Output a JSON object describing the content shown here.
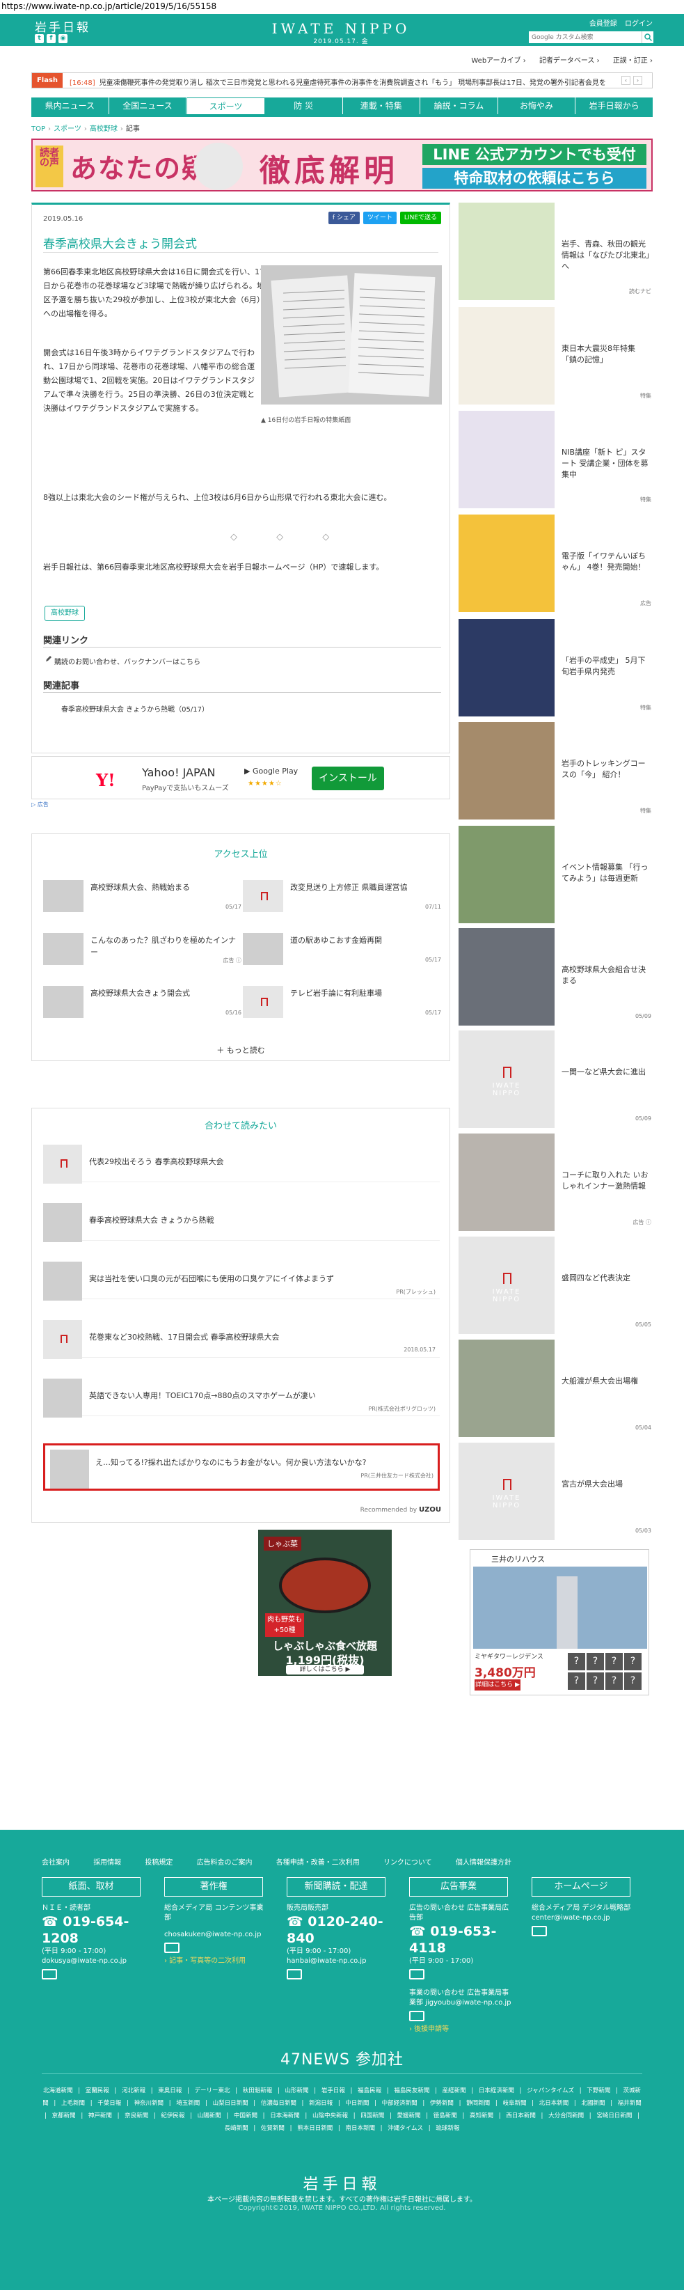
{
  "url": "https://www.iwate-np.co.jp/article/2019/5/16/55158",
  "header": {
    "logo": "岩手日報",
    "brand": "IWATE NIPPO",
    "date": "2019.05.17. 金",
    "links": [
      "会員登録",
      "ログイン"
    ],
    "search_placeholder": "Google カスタム検索",
    "social_icons": [
      "twitter-icon",
      "facebook-icon",
      "rss-icon"
    ]
  },
  "util_links": [
    "Webアーカイブ ›",
    "記者データベース ›",
    "正誤・訂正 ›"
  ],
  "flash": {
    "label": "Flash",
    "date": "[16:48]",
    "text": "児童凍傷鞭死事件の発覚取り消し 稲次で三日市発覚と思われる児童虐待死事件の消事件を消費院調査され「もう」 現場刑事部長は17日、発覚の署外引記者会見を行い",
    "prev": "‹",
    "next": "›"
  },
  "nav": {
    "items": [
      "県内ニュース",
      "全国ニュース",
      "スポーツ",
      "防 災",
      "連載・特集",
      "論説・コラム",
      "お悔やみ",
      "岩手日報から"
    ],
    "active_index": 2
  },
  "breadcrumb": [
    "TOP",
    "スポーツ",
    "高校野球",
    "記事"
  ],
  "banner": {
    "kuchi": "読者の声",
    "title": "あなたの疑問",
    "tettei": "徹底解明",
    "line1": "LINE 公式アカウントでも受付",
    "line2": "特命取材の依頼はこちら"
  },
  "article": {
    "date": "2019.05.16",
    "share": [
      "f シェア",
      "ツイート",
      "LINEで送る"
    ],
    "headline": "春季高校県大会きょう開会式",
    "p1": "第66回春季東北地区高校野球県大会は16日に開会式を行い、17日から花巻市の花巻球場など3球場で熱戦が繰り広げられる。地区予選を勝ち抜いた29校が参加し、上位3校が東北大会（6月）への出場権を得る。",
    "p2": "開会式は16日午後3時からイワテグランドスタジアムで行われ、17日から同球場、花巻市の花巻球場、八幡平市の総合運動公園球場で1、2回戦を実施。20日はイワテグランドスタジアムで準々決勝を行う。25日の準決勝、26日の3位決定戦と決勝はイワテグランドスタジアムで実施する。",
    "photo_caption": "16日付の岩手日報の特集紙面",
    "p3": "8強以上は東北大会のシード権が与えられ、上位3校は6月6日から山形県で行われる東北大会に進む。",
    "diamonds": "◇ ◇ ◇",
    "p4": "岩手日報社は、第66回春季東北地区高校野球県大会を岩手日報ホームページ（HP）で速報します。",
    "tag": "高校野球",
    "related_links_heading": "関連リンク",
    "related_link": "購読のお問い合わせ、バックナンバーはこちら",
    "related_articles_heading": "関連記事",
    "related_article": "春季高校野球県大会 きょうから熱戦（05/17）"
  },
  "ad_yahoo": {
    "logo": "Y!",
    "name": "Yahoo! JAPAN",
    "desc": "PayPayで支払いもスムーズ",
    "store": "Google Play",
    "stars": "★★★★☆",
    "install": "インストール",
    "ad_mark": "▷ 広告"
  },
  "access": {
    "title": "アクセス上位",
    "items": [
      {
        "text": "高校野球県大会、熱戦始まる",
        "date": "05/17",
        "thumb": "photo"
      },
      {
        "text": "改変見送り上方修正 県職員運営協",
        "date": "07/11",
        "thumb": "placeholder"
      },
      {
        "text": "こんなのあった？肌ざわりを極めたインナー",
        "date": "広告 ⓘ",
        "thumb": "photo"
      },
      {
        "text": "道の駅あゆこおす金婚再開",
        "date": "05/17",
        "thumb": "photo"
      },
      {
        "text": "高校野球県大会きょう開会式",
        "date": "05/16",
        "thumb": "photo"
      },
      {
        "text": "テレビ岩手論に有利駐車場",
        "date": "05/17",
        "thumb": "placeholder"
      }
    ],
    "more": "＋ もっと読む"
  },
  "recommend": {
    "title": "合わせて読みたい",
    "items": [
      {
        "text": "代表29校出そろう 春季高校野球県大会",
        "meta": "",
        "thumb": "placeholder"
      },
      {
        "text": "春季高校野球県大会 きょうから熱戦",
        "meta": "",
        "thumb": "photo"
      },
      {
        "text": "実は当社を使い口臭の元が石団喉にも使用の口臭ケアにイイ体よまうず",
        "meta": "PR(ブレッシュ)",
        "thumb": "photo"
      },
      {
        "text": "花巻東など30校熱戦、17日開会式 春季高校野球県大会",
        "meta": "2018.05.17",
        "thumb": "placeholder"
      },
      {
        "text": "英語できない人専用！TOEIC170点→880点のスマホゲームが凄い",
        "meta": "PR(株式会社ポリグロッツ)",
        "thumb": "photo"
      }
    ],
    "highlight": {
      "text": "え…知ってる!?採れ出たばかりなのにもうお金がない。何か良い方法ないかな?",
      "meta": "PR(三井住友カード株式会社)",
      "thumb": "photo"
    },
    "by_label": "Recommended by",
    "by_brand": "UZOU"
  },
  "ad_shabu": {
    "brand": "しゃぶ菜",
    "tag": "肉も野菜も +50種",
    "copy": "しゃぶしゃぶ食べ放題",
    "price": "1,199円(税抜)",
    "btn": "詳しくはこちら ▶"
  },
  "ad_tower": {
    "brand": "三井のリハウス",
    "name": "ミヤギタワーレジデンス",
    "price": "3,480万円",
    "btn": "詳細はこちら ▶",
    "marks": [
      "?",
      "?",
      "?",
      "?",
      "?",
      "?",
      "?",
      "?"
    ]
  },
  "sidebar": [
    {
      "text": "岩手、青森、秋田の観光情報は「なびたび北東北」へ",
      "meta": "読むナビ",
      "thumb": "photo"
    },
    {
      "text": "東日本大震災8年特集 「鎮の記憶」",
      "meta": "特集",
      "thumb": "photo"
    },
    {
      "text": "NIB講座「新ト ピ」スタート 受講企業・団体を募集中",
      "meta": "特集",
      "thumb": "photo"
    },
    {
      "text": "電子版「イワテんいぼちゃん」 4巻！発売開始！",
      "meta": "広告",
      "thumb": "photo"
    },
    {
      "text": "「岩手の平成史」 5月下旬岩手県内発売",
      "meta": "特集",
      "thumb": "photo"
    },
    {
      "text": "岩手のトレッキングコースの「今」 紹介！",
      "meta": "特集",
      "thumb": "photo"
    },
    {
      "text": "イベント情報募集 「行ってみよう」は毎週更新",
      "meta": "",
      "thumb": "photo"
    },
    {
      "text": "高校野球県大会組合せ決まる",
      "meta": "05/09",
      "thumb": "photo"
    },
    {
      "text": "一関一など県大会に進出",
      "meta": "05/09",
      "thumb": "placeholder"
    },
    {
      "text": "コーチに取り入れた いおしゃれインナー激熱情報",
      "meta": "広告 ⓘ",
      "thumb": "photo"
    },
    {
      "text": "盛岡四など代表決定",
      "meta": "05/05",
      "thumb": "placeholder"
    },
    {
      "text": "大船渡が県大会出場権",
      "meta": "05/04",
      "thumb": "photo"
    },
    {
      "text": "宮古が県大会出場",
      "meta": "05/03",
      "thumb": "placeholder"
    }
  ],
  "footer": {
    "links": [
      "会社案内",
      "採用情報",
      "投稿規定",
      "広告料金のご案内",
      "各種申請・改善・二次利用",
      "リンクについて",
      "個人情報保護方針"
    ],
    "boxes": [
      "紙面、取材",
      "著作権",
      "新聞購読・配達",
      "広告事業",
      "ホームページ"
    ],
    "cols": [
      {
        "org": "ＮＩＥ・読者部",
        "tel": "019-654-1208",
        "hours": "(平日 9:00 ‐ 17:00)",
        "email": "dokusya@iwate-np.co.jp",
        "extra": ""
      },
      {
        "org": "総合メディア局 コンテンツ事業部",
        "tel": "",
        "hours": "",
        "email": "chosakuken@iwate-np.co.jp",
        "extra": "› 記事・写真等の二次利用"
      },
      {
        "org": "販売局販売部",
        "tel": "0120-240-840",
        "hours": "(平日 9:00 ‐ 17:00)",
        "email": "hanbai@iwate-np.co.jp",
        "extra": ""
      },
      {
        "org": "広告の問い合わせ 広告事業局広告部",
        "tel": "019-653-4118",
        "hours": "(平日 9:00 ‐ 17:00)",
        "email": "事業の問い合わせ 広告事業局事業部 jigyoubu@iwate-np.co.jp",
        "extra": "› 後援申請等"
      },
      {
        "org": "総合メディア局 デジタル戦略部",
        "tel": "",
        "hours": "",
        "email": "center@iwate-np.co.jp",
        "extra": ""
      }
    ],
    "news47": "47NEWS 参加社",
    "papers": "北海道新聞 | 室蘭民報 | 河北新報 | 東奥日報 | デーリー東北 | 秋田魁新報 | 山形新聞 | 岩手日報 | 福島民報 | 福島民友新聞 | 産経新聞 | 日本経済新聞 | ジャパンタイムズ | 下野新聞 | 茨城新聞 | 上毛新聞 | 千葉日報 | 神奈川新聞 | 埼玉新聞 | 山梨日日新聞 | 信濃毎日新聞 | 新潟日報 | 中日新聞 | 中部経済新聞 | 伊勢新聞 | 静岡新聞 | 岐阜新聞 | 北日本新聞 | 北國新聞 | 福井新聞 | 京都新聞 | 神戸新聞 | 奈良新聞 | 紀伊民報 | 山陽新聞 | 中国新聞 | 日本海新聞 | 山陰中央新報 | 四国新聞 | 愛媛新聞 | 徳島新聞 | 高知新聞 | 西日本新聞 | 大分合同新聞 | 宮崎日日新聞 | 長崎新聞 | 佐賀新聞 | 熊本日日新聞 | 南日本新聞 | 沖縄タイムス | 琉球新報",
    "logo": "岩手日報",
    "notice": "本ページ掲載内容の無断転載を禁じます。すべての著作権は岩手日報社に帰属します。",
    "copyright": "Copyright©2019, IWATE NIPPO CO.,LTD. All rights reserved."
  },
  "colors": {
    "accent": "#17a99a",
    "flash": "#e5542e",
    "banner_pink": "#c83264",
    "highlight_border": "#d81e1e"
  }
}
